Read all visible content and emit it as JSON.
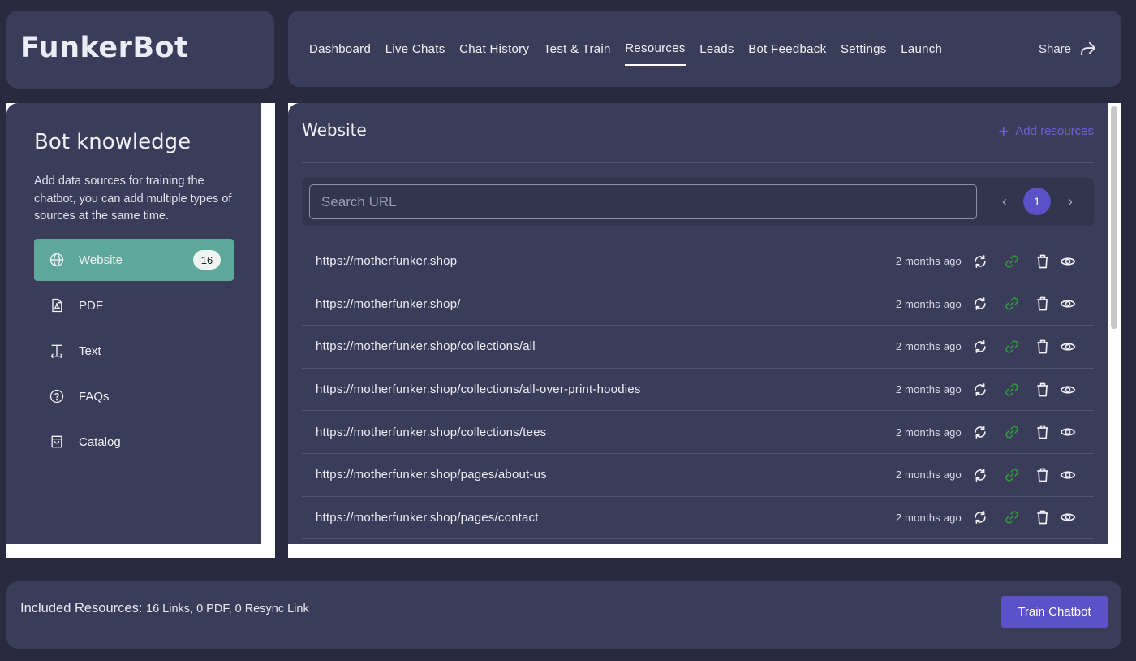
{
  "app": {
    "title": "FunkerBot"
  },
  "nav": {
    "items": [
      {
        "label": "Dashboard",
        "active": false
      },
      {
        "label": "Live Chats",
        "active": false
      },
      {
        "label": "Chat History",
        "active": false
      },
      {
        "label": "Test & Train",
        "active": false
      },
      {
        "label": "Resources",
        "active": true
      },
      {
        "label": "Leads",
        "active": false
      },
      {
        "label": "Bot Feedback",
        "active": false
      },
      {
        "label": "Settings",
        "active": false
      },
      {
        "label": "Launch",
        "active": false
      }
    ],
    "share_label": "Share"
  },
  "sidebar": {
    "title": "Bot knowledge",
    "description": "Add data sources for training the chatbot, you can add multiple types of sources at the same time.",
    "sources": [
      {
        "label": "Website",
        "icon": "globe-icon",
        "badge": "16",
        "active": true
      },
      {
        "label": "PDF",
        "icon": "pdf-file-icon",
        "active": false
      },
      {
        "label": "Text",
        "icon": "text-cursor-icon",
        "active": false
      },
      {
        "label": "FAQs",
        "icon": "question-circle-icon",
        "active": false
      },
      {
        "label": "Catalog",
        "icon": "shopping-bag-icon",
        "active": false
      }
    ]
  },
  "main": {
    "title": "Website",
    "add_resources_label": "Add resources",
    "search": {
      "placeholder": "Search URL",
      "value": ""
    },
    "pagination": {
      "current_page": "1",
      "prev_icon": "chevron-left-icon",
      "next_icon": "chevron-right-icon"
    },
    "rows": [
      {
        "url": "https://motherfunker.shop",
        "time": "2 months ago"
      },
      {
        "url": "https://motherfunker.shop/",
        "time": "2 months ago"
      },
      {
        "url": "https://motherfunker.shop/collections/all",
        "time": "2 months ago"
      },
      {
        "url": "https://motherfunker.shop/collections/all-over-print-hoodies",
        "time": "2 months ago"
      },
      {
        "url": "https://motherfunker.shop/collections/tees",
        "time": "2 months ago"
      },
      {
        "url": "https://motherfunker.shop/pages/about-us",
        "time": "2 months ago"
      },
      {
        "url": "https://motherfunker.shop/pages/contact",
        "time": "2 months ago"
      }
    ],
    "row_icons": [
      "sync-icon",
      "link-icon",
      "trash-icon",
      "eye-icon"
    ]
  },
  "footer": {
    "label": "Included Resources:",
    "value": "16 Links, 0 PDF, 0 Resync Link",
    "train_button": "Train Chatbot"
  },
  "colors": {
    "background": "#292a40",
    "panel": "#3b3c59",
    "accent": "#5b52c9",
    "active_source": "#5ea89a",
    "link_icon": "#2e9a3e"
  }
}
